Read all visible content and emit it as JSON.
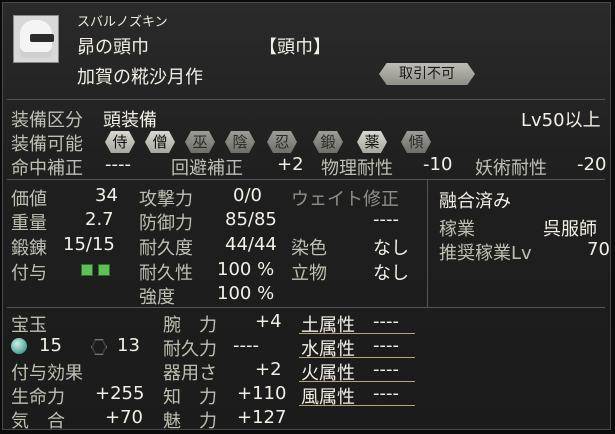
{
  "item": {
    "reading": "スバルノズキン",
    "name": "昴の頭巾",
    "type": "【頭巾】",
    "maker": "加賀の糀沙月作",
    "trade_badge": "取引不可"
  },
  "equip": {
    "slot_label": "装備区分",
    "slot_value": "頭装備",
    "level_req": "Lv50以上",
    "roles_label": "装備可能",
    "roles": [
      {
        "label": "侍",
        "enabled": true
      },
      {
        "label": "僧",
        "enabled": true
      },
      {
        "label": "巫",
        "enabled": false
      },
      {
        "label": "陰",
        "enabled": false
      },
      {
        "label": "忍",
        "enabled": false
      },
      {
        "label": "鍛",
        "enabled": false
      },
      {
        "label": "薬",
        "enabled": true
      },
      {
        "label": "傾",
        "enabled": false
      }
    ]
  },
  "mods": {
    "hit_label": "命中補正",
    "hit_value": "----",
    "evade_label": "回避補正",
    "evade_value": "+2",
    "phys_label": "物理耐性",
    "phys_value": "-10",
    "magic_label": "妖術耐性",
    "magic_value": "-20"
  },
  "stats_left": {
    "price_label": "価値",
    "price_value": "34",
    "weight_label": "重量",
    "weight_value": "2.7",
    "forge_label": "鍛錬",
    "forge_value": "15/15",
    "grant_label": "付与"
  },
  "stats_mid": {
    "atk_label": "攻撃力",
    "atk_value": "0/0",
    "def_label": "防御力",
    "def_value": "85/85",
    "dur_label": "耐久度",
    "dur_value": "44/44",
    "durability_label": "耐久性",
    "durability_value": "100 %",
    "strength_label": "強度",
    "strength_value": "100 %"
  },
  "stats_right": {
    "weight_mod_label": "ウェイト修正",
    "weight_mod_value": "----",
    "dye_label": "染色",
    "dye_value": "なし",
    "standing_label": "立物",
    "standing_value": "なし"
  },
  "fusion": {
    "title": "融合済み",
    "trade_label": "稼業",
    "trade_value": "呉服師",
    "rec_label": "推奨稼業Lv",
    "rec_value": "70"
  },
  "gems": {
    "label": "宝玉",
    "round_count": "15",
    "hex_count": "13"
  },
  "effects": {
    "label": "付与効果",
    "life_label": "生命力",
    "life_value": "+255",
    "spirit_label": "気　合",
    "spirit_value": "+70"
  },
  "attrs": {
    "arm_label": "腕　力",
    "arm_value": "+4",
    "stam_label": "耐久力",
    "stam_value": "----",
    "dex_label": "器用さ",
    "dex_value": "+2",
    "int_label": "知　力",
    "int_value": "+110",
    "cha_label": "魅　力",
    "cha_value": "+127"
  },
  "elements": [
    {
      "label": "土属性",
      "value": "----"
    },
    {
      "label": "水属性",
      "value": "----"
    },
    {
      "label": "火属性",
      "value": "----"
    },
    {
      "label": "風属性",
      "value": "----"
    }
  ],
  "colors": {
    "grant_indicator": "#5fbf5a",
    "gem_round": "#5fb0a3"
  }
}
